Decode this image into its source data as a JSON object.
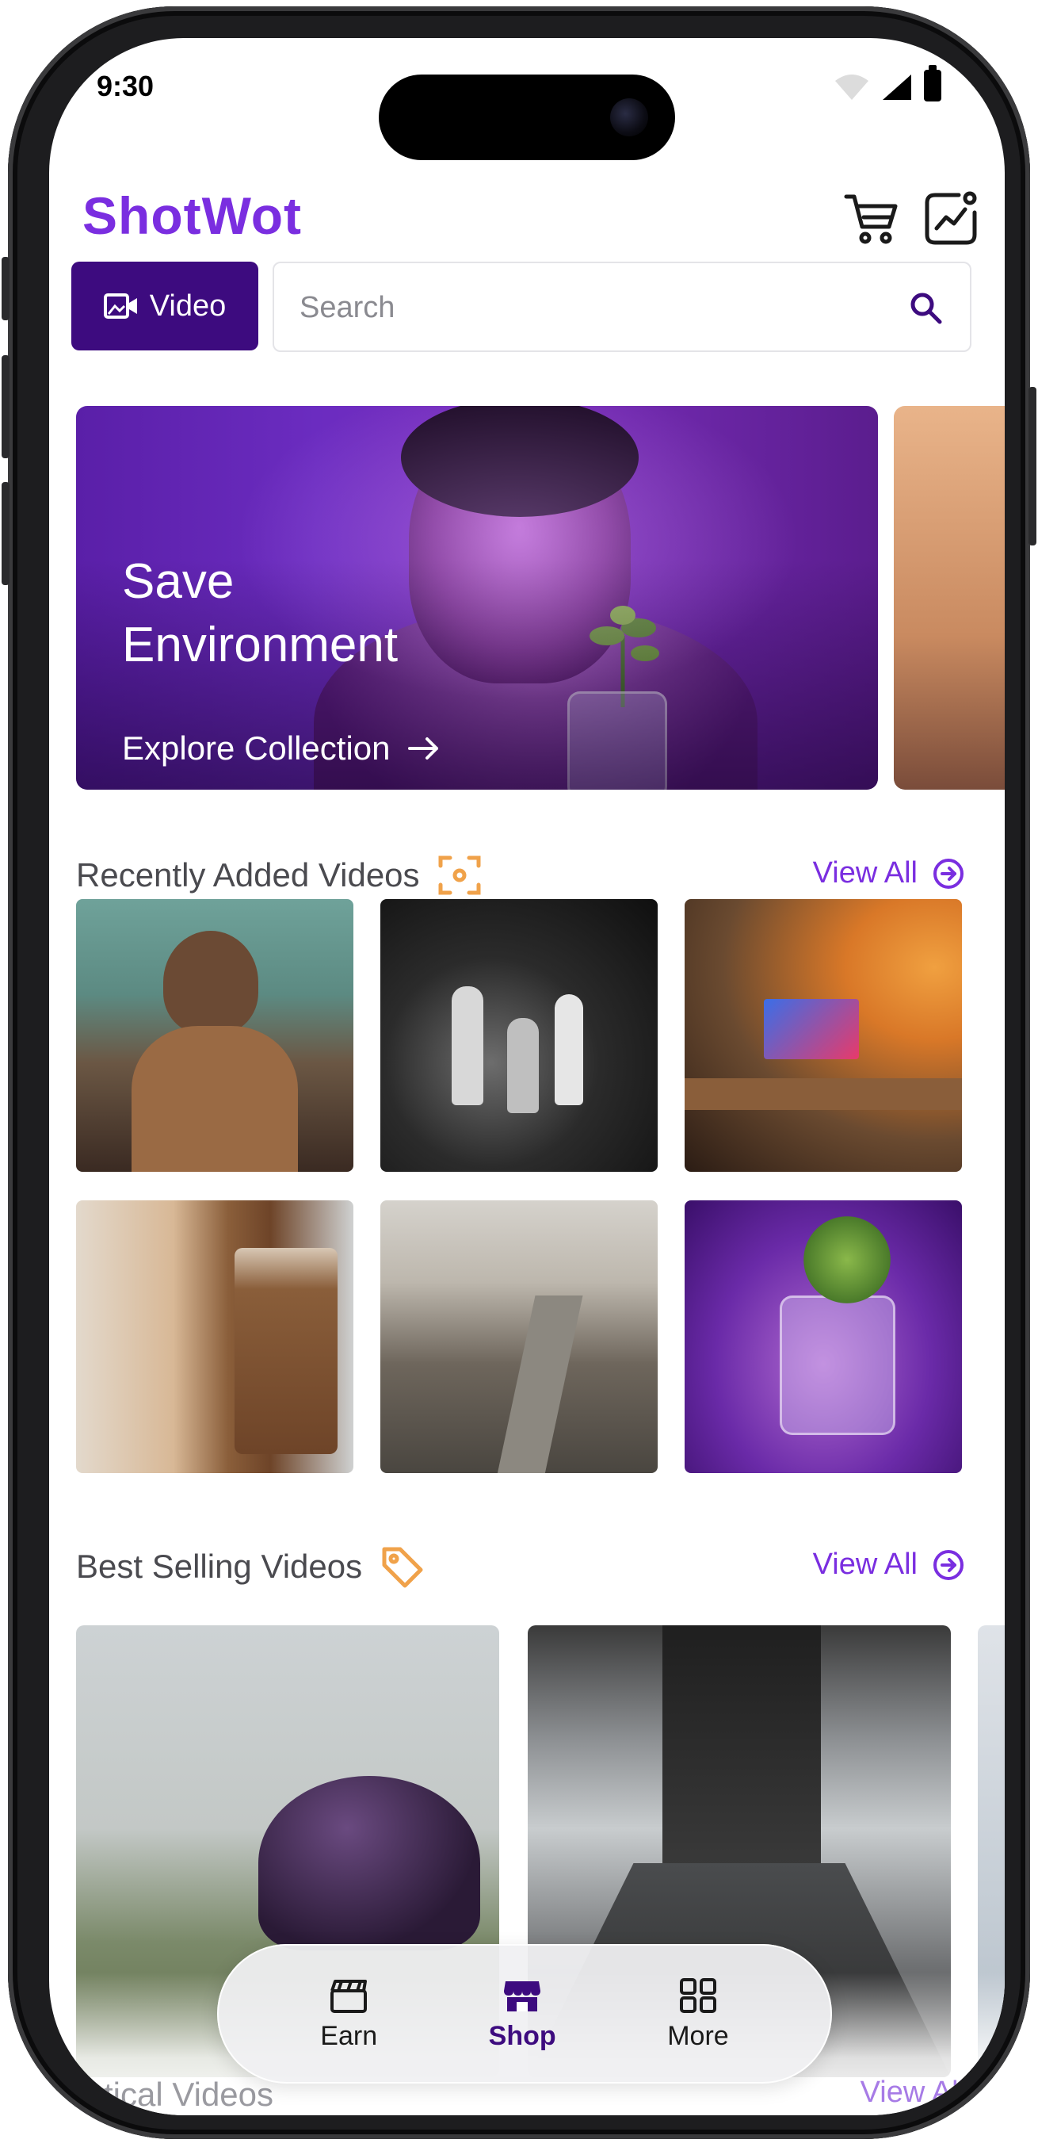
{
  "status_bar": {
    "time": "9:30"
  },
  "header": {
    "logo": "ShotWot",
    "icons": [
      "cart-icon",
      "analytics-icon"
    ]
  },
  "search": {
    "type_button_label": "Video",
    "placeholder": "Search",
    "value": ""
  },
  "hero": {
    "title": "Save Environment",
    "link_label": "Explore Collection"
  },
  "sections": {
    "recent": {
      "title": "Recently Added Videos",
      "view_all": "View All",
      "icon": "focus-icon"
    },
    "best_selling": {
      "title": "Best Selling Videos",
      "view_all": "View All",
      "icon": "tag-icon"
    },
    "peek": {
      "title": "...tical Videos",
      "view_all": "View All"
    }
  },
  "tabbar": {
    "items": [
      {
        "label": "Earn",
        "icon": "clapperboard-icon",
        "active": false
      },
      {
        "label": "Shop",
        "icon": "shop-icon",
        "active": true
      },
      {
        "label": "More",
        "icon": "grid-icon",
        "active": false
      }
    ]
  },
  "colors": {
    "brand": "#7a2ee0",
    "button_dark": "#3d0b7f",
    "section_icon": "#f0a24a"
  }
}
